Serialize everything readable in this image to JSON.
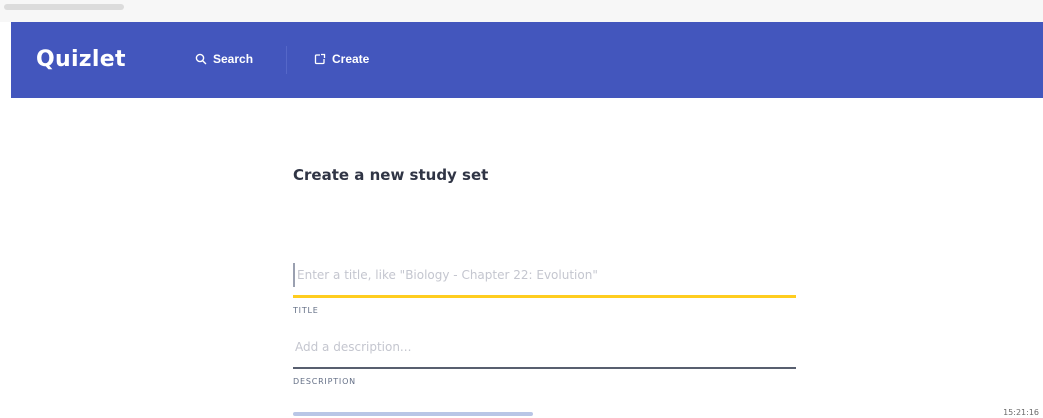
{
  "navbar": {
    "brand": "Quizlet",
    "search_label": "Search",
    "create_label": "Create",
    "background_color": "#4356bd",
    "search_icon": "search-icon",
    "create_icon": "create-icon"
  },
  "main": {
    "page_title": "Create a new study set",
    "title_field": {
      "value": "",
      "placeholder": "Enter a title, like \"Biology - Chapter 22: Evolution\"",
      "label": "TITLE",
      "underline_color": "#ffcd1f"
    },
    "description_field": {
      "value": "",
      "placeholder": "Add a description...",
      "label": "DESCRIPTION",
      "underline_color": "#585f6f"
    }
  },
  "status": {
    "timestamp": "15:21:16"
  }
}
